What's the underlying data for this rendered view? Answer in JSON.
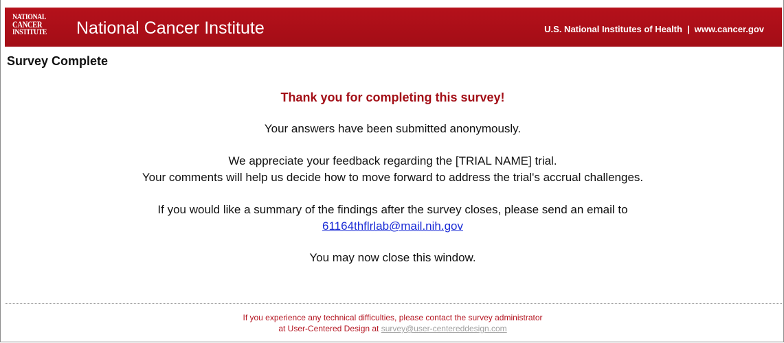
{
  "header": {
    "logo_lines": [
      "NATIONAL",
      "CANCER",
      "INSTITUTE"
    ],
    "title": "National Cancer Institute",
    "nih_link": "U.S. National Institutes of Health",
    "separator": "|",
    "site_link": "www.cancer.gov"
  },
  "page": {
    "title": "Survey Complete"
  },
  "message": {
    "thanks": "Thank you for completing this survey!",
    "submitted": "Your answers have been submitted anonymously.",
    "appreciate": "We appreciate your feedback regarding the [TRIAL NAME] trial.",
    "comments": "Your comments will help us decide how to move forward to address the trial's accrual challenges.",
    "summary": "If you would like a summary of the findings after the survey closes, please send an email to",
    "email": "61164thflrlab@mail.nih.gov",
    "close": "You may now close this window."
  },
  "footer": {
    "line1": "If you experience any technical difficulties, please contact the survey administrator",
    "line2_prefix": "at User-Centered Design at",
    "admin_email": "survey@user-centereddesign.com"
  },
  "colors": {
    "banner": "#a30d16",
    "accent_text": "#a30f17",
    "link": "#1a2bd6",
    "footer_link": "#a0a0a0"
  }
}
